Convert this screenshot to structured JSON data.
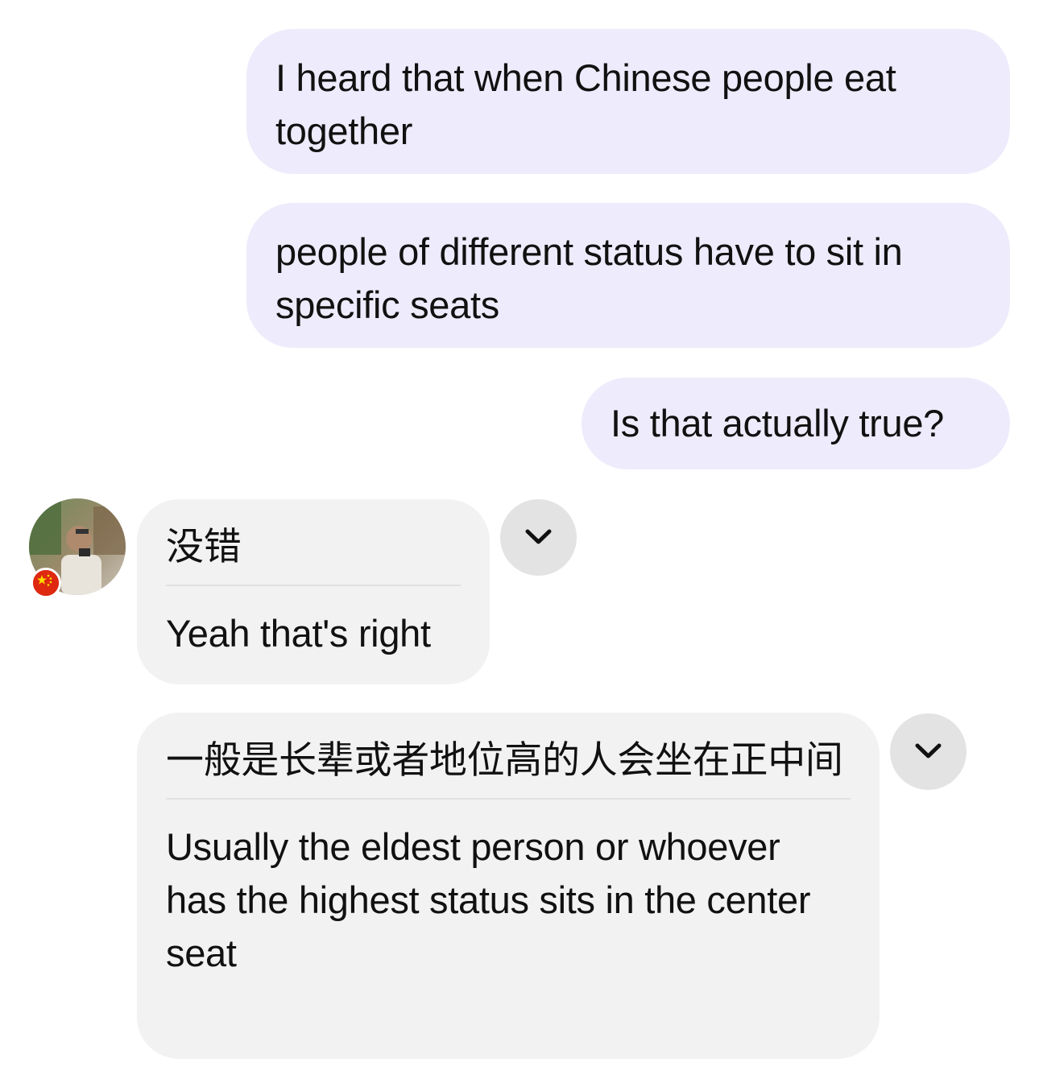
{
  "conversation": {
    "outgoing": [
      {
        "text": "I heard that when Chinese people eat together"
      },
      {
        "text": "people of different status have to sit in specific seats"
      },
      {
        "text": "Is that actually true?"
      }
    ],
    "incoming": [
      {
        "original": "没错",
        "translation": "Yeah that's right"
      },
      {
        "original": "一般是长辈或者地位高的人会坐在正中间",
        "translation": "Usually the eldest person or whoever has the highest status sits in the center seat"
      }
    ]
  },
  "contact": {
    "avatar_icon": "avatar-photo",
    "flag_icon": "china-flag-icon"
  },
  "icons": {
    "expand": "chevron-down-icon"
  },
  "colors": {
    "outgoing_bubble": "#eeebfc",
    "incoming_bubble": "#f2f2f2",
    "chevron_button": "#e3e3e3"
  }
}
